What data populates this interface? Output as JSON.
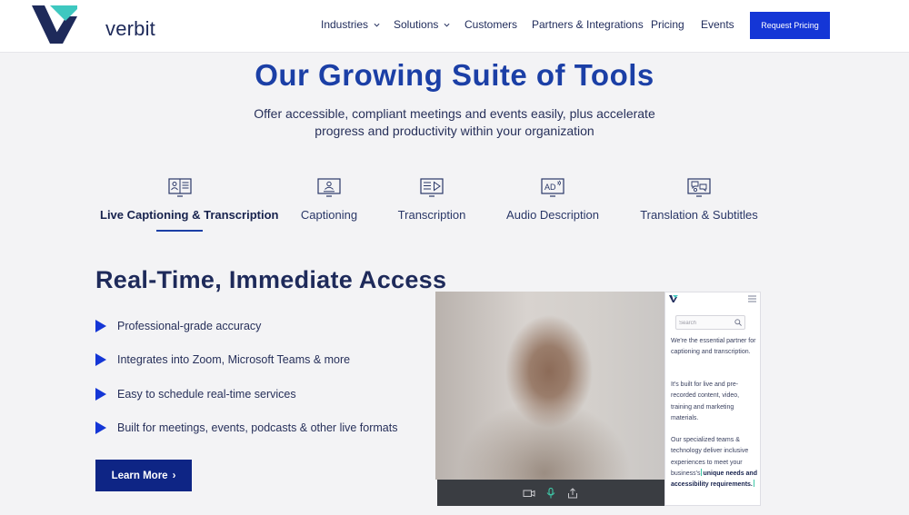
{
  "header": {
    "logo_text": "verbit",
    "nav": [
      {
        "label": "Industries",
        "has_dropdown": true
      },
      {
        "label": "Solutions",
        "has_dropdown": true
      },
      {
        "label": "Customers",
        "has_dropdown": false
      },
      {
        "label": "Partners & Integrations",
        "has_dropdown": false
      },
      {
        "label": "Pricing",
        "has_dropdown": false
      },
      {
        "label": "Events",
        "has_dropdown": false
      }
    ],
    "cta_label": "Request Pricing"
  },
  "hero": {
    "title": "Our Growing Suite of Tools",
    "subtitle_line1": "Offer accessible, compliant meetings and events easily, plus accelerate",
    "subtitle_line2": "progress and productivity within your organization"
  },
  "tabs": [
    {
      "label": "Live Captioning & Transcription",
      "icon": "live-captioning-icon",
      "active": true
    },
    {
      "label": "Captioning",
      "icon": "captioning-icon",
      "active": false
    },
    {
      "label": "Transcription",
      "icon": "transcription-icon",
      "active": false
    },
    {
      "label": "Audio Description",
      "icon": "audio-description-icon",
      "active": false
    },
    {
      "label": "Translation & Subtitles",
      "icon": "translation-icon",
      "active": false
    }
  ],
  "feature": {
    "title": "Real-Time, Immediate Access",
    "bullets": [
      "Professional-grade accuracy",
      "Integrates into Zoom, Microsoft Teams & more",
      "Easy to schedule real-time services",
      "Built for meetings, events, podcasts & other live formats"
    ],
    "cta_label": "Learn More",
    "cta_arrow": "›"
  },
  "panel": {
    "search_placeholder": "Search",
    "para1": "We're the essential partner for captioning and transcription.",
    "para2": "It's built for live and pre-recorded content, video, training and marketing materials.",
    "para3_plain": "Our specialized teams & technology deliver inclusive experiences to meet your business's",
    "para3_bold": "unique needs and accessibility requirements."
  },
  "colors": {
    "brand_navy": "#1e2a5a",
    "accent_blue": "#1436d6",
    "title_blue": "#1b3fa6",
    "brand_teal": "#3ec8c0",
    "background": "#f3f3f5"
  }
}
